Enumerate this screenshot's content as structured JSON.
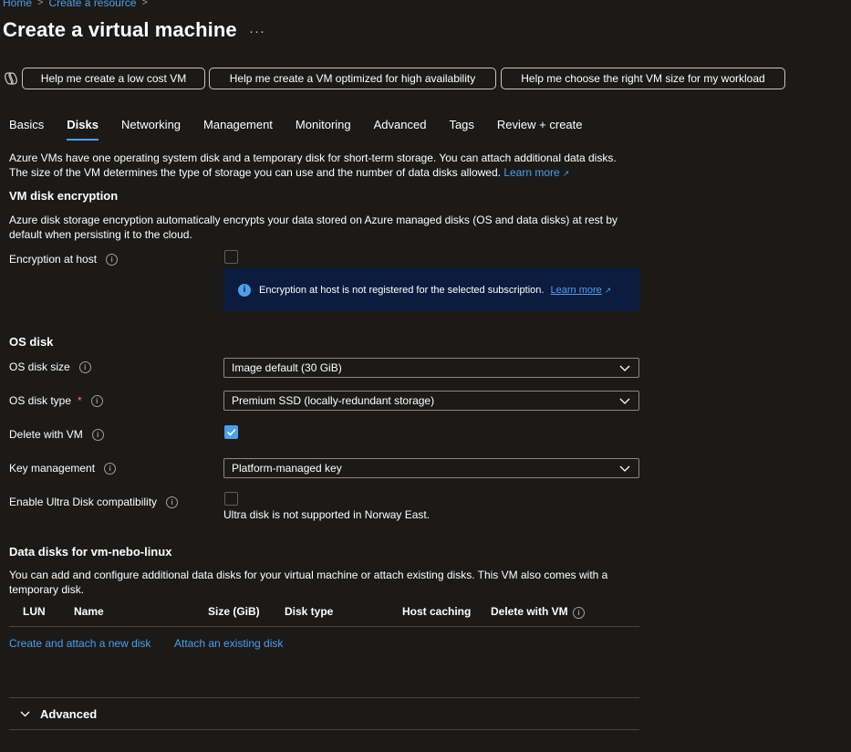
{
  "breadcrumb": {
    "home": "Home",
    "create_resource": "Create a resource",
    "sep": ">"
  },
  "page": {
    "title": "Create a virtual machine",
    "more": "···"
  },
  "copilot": {
    "pill1": "Help me create a low cost VM",
    "pill2": "Help me create a VM optimized for high availability",
    "pill3": "Help me choose the right VM size for my workload"
  },
  "tabs": [
    "Basics",
    "Disks",
    "Networking",
    "Management",
    "Monitoring",
    "Advanced",
    "Tags",
    "Review + create"
  ],
  "active_tab": "Disks",
  "intro": {
    "text": "Azure VMs have one operating system disk and a temporary disk for short-term storage. You can attach additional data disks. The size of the VM determines the type of storage you can use and the number of data disks allowed.",
    "learn_more": "Learn more"
  },
  "encryption": {
    "heading": "VM disk encryption",
    "description": "Azure disk storage encryption automatically encrypts your data stored on Azure managed disks (OS and data disks) at rest by default when persisting it to the cloud.",
    "host_label": "Encryption at host",
    "host_checked": false,
    "info_text": "Encryption at host is not registered for the selected subscription.",
    "info_link": "Learn more"
  },
  "os_disk": {
    "heading": "OS disk",
    "size_label": "OS disk size",
    "size_value": "Image default (30 GiB)",
    "type_label": "OS disk type",
    "type_required": "*",
    "type_value": "Premium SSD (locally-redundant storage)",
    "delete_label": "Delete with VM",
    "delete_checked": true,
    "key_label": "Key management",
    "key_value": "Platform-managed key",
    "ultra_label": "Enable Ultra Disk compatibility",
    "ultra_checked": false,
    "ultra_note": "Ultra disk is not supported in Norway East."
  },
  "data_disks": {
    "heading": "Data disks for vm-nebo-linux",
    "description": "You can add and configure additional data disks for your virtual machine or attach existing disks. This VM also comes with a temporary disk.",
    "columns": [
      "LUN",
      "Name",
      "Size (GiB)",
      "Disk type",
      "Host caching",
      "Delete with VM"
    ],
    "create_link": "Create and attach a new disk",
    "attach_link": "Attach an existing disk"
  },
  "advanced": {
    "label": "Advanced"
  },
  "colors": {
    "accent": "#4f9fe8",
    "background": "#1b1a19",
    "info_bg": "#0c1c3e",
    "required": "#f1707b"
  }
}
